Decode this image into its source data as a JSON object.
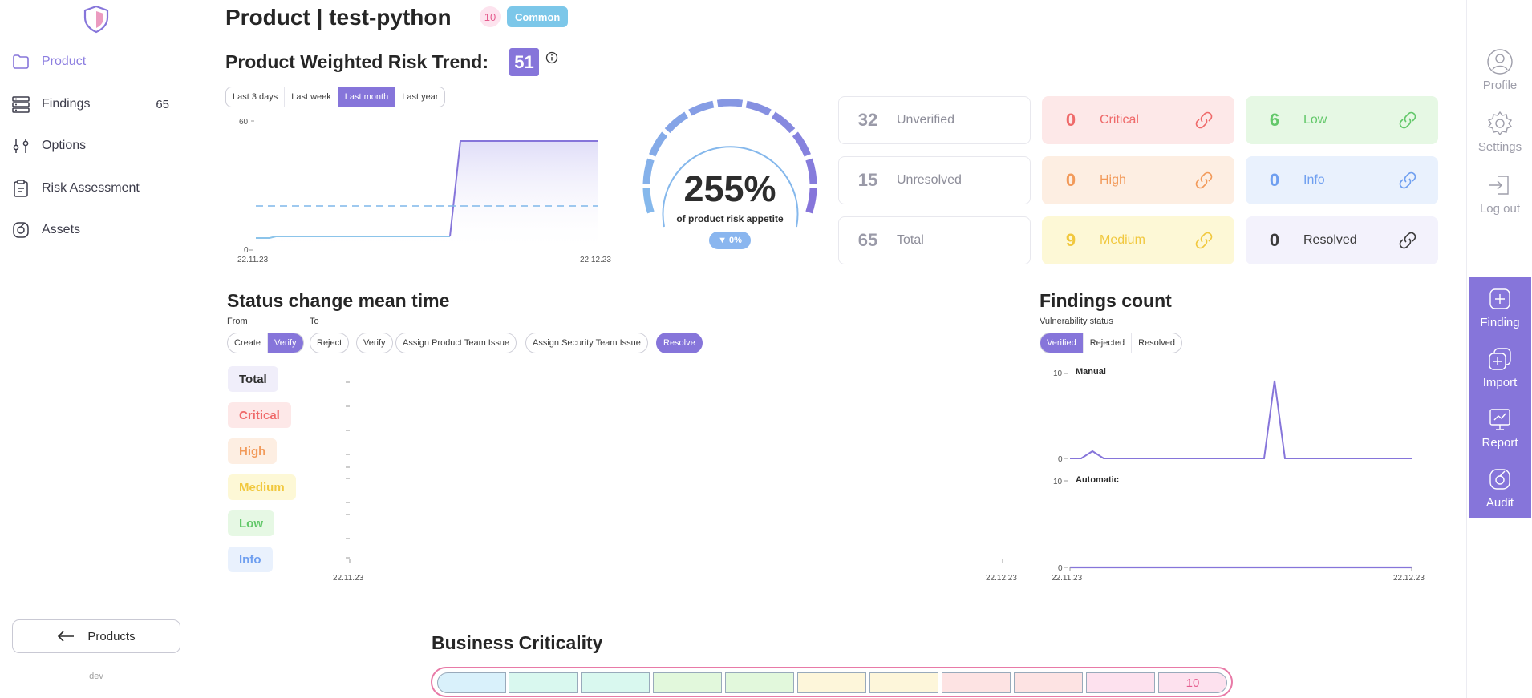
{
  "sidebar": {
    "items": [
      {
        "label": "Product",
        "icon": "folder-icon",
        "active": true
      },
      {
        "label": "Findings",
        "icon": "server-icon",
        "count": "65"
      },
      {
        "label": "Options",
        "icon": "sliders-icon"
      },
      {
        "label": "Risk Assessment",
        "icon": "clipboard-icon"
      },
      {
        "label": "Assets",
        "icon": "assets-icon"
      }
    ],
    "back_label": "Products",
    "env": "dev"
  },
  "header": {
    "title": "Product | test-python",
    "count_badge": "10",
    "tier_badge": "Common"
  },
  "risk_trend": {
    "title": "Product Weighted Risk Trend:",
    "score": "51",
    "ranges": [
      "Last 3 days",
      "Last week",
      "Last month",
      "Last year"
    ],
    "selected_range": "Last month",
    "y_ticks": [
      "60",
      "0"
    ],
    "x_ticks": [
      "22.11.23",
      "22.12.23"
    ]
  },
  "gauge": {
    "value": "255%",
    "subtitle": "of product risk appetite",
    "delta": "▼ 0%"
  },
  "cards": [
    {
      "num": "32",
      "label": "Unverified",
      "style": "plain"
    },
    {
      "num": "0",
      "label": "Critical",
      "style": "critical"
    },
    {
      "num": "6",
      "label": "Low",
      "style": "low"
    },
    {
      "num": "15",
      "label": "Unresolved",
      "style": "plain"
    },
    {
      "num": "0",
      "label": "High",
      "style": "high"
    },
    {
      "num": "0",
      "label": "Info",
      "style": "info"
    },
    {
      "num": "65",
      "label": "Total",
      "style": "plain"
    },
    {
      "num": "9",
      "label": "Medium",
      "style": "medium"
    },
    {
      "num": "0",
      "label": "Resolved",
      "style": "resolved"
    }
  ],
  "colors": {
    "accent": "#8675da",
    "critical": "#ef6a6a",
    "high": "#f29a5a",
    "medium": "#f1c83e",
    "low": "#63c86a",
    "info": "#6f9ff0"
  },
  "status_change": {
    "title": "Status change mean time",
    "from_label": "From",
    "to_label": "To",
    "from_options": [
      "Create",
      "Verify"
    ],
    "from_selected": "Verify",
    "to_options": [
      "Reject",
      "Verify",
      "Assign Product Team Issue",
      "Assign Security Team Issue",
      "Resolve"
    ],
    "to_selected": "Resolve",
    "severities": [
      "Total",
      "Critical",
      "High",
      "Medium",
      "Low",
      "Info"
    ],
    "x_ticks": [
      "22.11.23",
      "22.12.23"
    ]
  },
  "findings_count": {
    "title": "Findings count",
    "subtitle": "Vulnerability status",
    "options": [
      "Verified",
      "Rejected",
      "Resolved"
    ],
    "selected": "Verified",
    "charts": [
      {
        "label": "Manual",
        "y_max": "10",
        "y_min": "0"
      },
      {
        "label": "Automatic",
        "y_max": "10",
        "y_min": "0"
      }
    ],
    "x_ticks": [
      "22.11.23",
      "22.12.23"
    ]
  },
  "business_criticality": {
    "title": "Business Criticality",
    "value": "10"
  },
  "rail": {
    "top": [
      {
        "label": "Profile",
        "icon": "user-circle-icon"
      },
      {
        "label": "Settings",
        "icon": "gear-icon"
      },
      {
        "label": "Log out",
        "icon": "logout-icon"
      }
    ],
    "actions": [
      {
        "label": "Finding",
        "icon": "plus-square-icon"
      },
      {
        "label": "Import",
        "icon": "import-icon"
      },
      {
        "label": "Report",
        "icon": "presentation-icon"
      },
      {
        "label": "Audit",
        "icon": "audit-icon"
      }
    ]
  }
}
